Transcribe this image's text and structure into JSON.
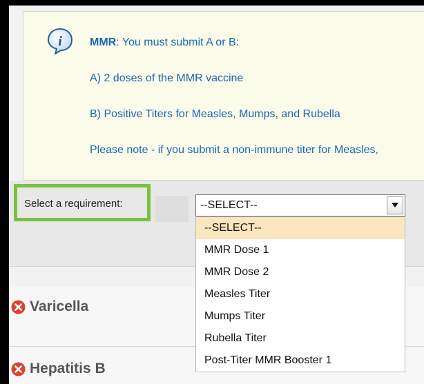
{
  "info": {
    "title_bold": "MMR",
    "title_rest": ": You must submit A or B:",
    "line_a": "A) 2 doses of the MMR vaccine",
    "line_b": "B) Positive Titers for Measles, Mumps, and Rubella",
    "line_note": "Please note - if you submit a non-immune titer for Measles,",
    "icon": "info-icon"
  },
  "requirement": {
    "label": "Select a requirement:",
    "selected": "--SELECT--",
    "options": [
      "--SELECT--",
      "MMR Dose 1",
      "MMR Dose 2",
      "Measles Titer",
      "Mumps Titer",
      "Rubella Titer",
      "Post-Titer MMR Booster 1"
    ]
  },
  "sections": [
    {
      "title": "Varicella",
      "status_icon": "x-circle-icon"
    },
    {
      "title": "Hepatitis B",
      "status_icon": "x-circle-icon"
    }
  ],
  "colors": {
    "info_text": "#1a66b8",
    "highlight_border": "#7ac142",
    "option_highlight": "#fbe6bf",
    "status_red": "#d9432f"
  }
}
